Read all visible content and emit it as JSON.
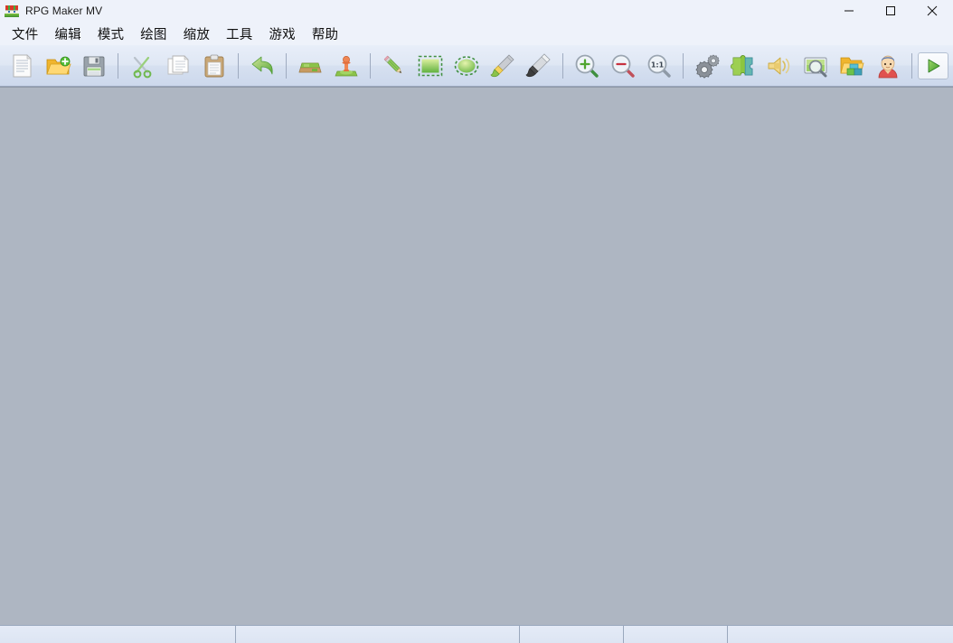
{
  "window": {
    "title": "RPG Maker MV",
    "app_icon": "rpgmaker-logo-icon",
    "controls": {
      "minimize": "–",
      "maximize": "□",
      "close": "✕"
    }
  },
  "menubar": {
    "items": [
      {
        "label": "文件",
        "name": "menu-file"
      },
      {
        "label": "编辑",
        "name": "menu-edit"
      },
      {
        "label": "模式",
        "name": "menu-mode"
      },
      {
        "label": "绘图",
        "name": "menu-draw"
      },
      {
        "label": "缩放",
        "name": "menu-zoom"
      },
      {
        "label": "工具",
        "name": "menu-tools"
      },
      {
        "label": "游戏",
        "name": "menu-game"
      },
      {
        "label": "帮助",
        "name": "menu-help"
      }
    ]
  },
  "toolbar": {
    "groups": [
      {
        "name": "file-group",
        "buttons": [
          {
            "name": "new-project-button",
            "icon": "new-document-icon"
          },
          {
            "name": "open-project-button",
            "icon": "open-folder-icon"
          },
          {
            "name": "save-project-button",
            "icon": "floppy-save-icon"
          }
        ]
      },
      {
        "name": "clipboard-group",
        "buttons": [
          {
            "name": "cut-button",
            "icon": "scissors-icon"
          },
          {
            "name": "copy-button",
            "icon": "copy-pages-icon"
          },
          {
            "name": "paste-button",
            "icon": "clipboard-icon"
          }
        ]
      },
      {
        "name": "history-group",
        "buttons": [
          {
            "name": "undo-button",
            "icon": "undo-arrow-icon"
          }
        ]
      },
      {
        "name": "mode-group",
        "buttons": [
          {
            "name": "map-mode-button",
            "icon": "map-layer-icon"
          },
          {
            "name": "event-mode-button",
            "icon": "event-pawn-icon"
          }
        ]
      },
      {
        "name": "draw-group",
        "buttons": [
          {
            "name": "pencil-tool-button",
            "icon": "pencil-icon"
          },
          {
            "name": "rectangle-tool-button",
            "icon": "rectangle-select-icon"
          },
          {
            "name": "ellipse-tool-button",
            "icon": "ellipse-select-icon"
          },
          {
            "name": "fill-tool-button",
            "icon": "paint-brush-fill-icon"
          },
          {
            "name": "shadow-pen-tool-button",
            "icon": "shadow-pen-icon"
          }
        ]
      },
      {
        "name": "zoom-group",
        "buttons": [
          {
            "name": "zoom-in-button",
            "icon": "magnifier-plus-icon"
          },
          {
            "name": "zoom-out-button",
            "icon": "magnifier-minus-icon"
          },
          {
            "name": "zoom-actual-button",
            "icon": "magnifier-1to1-icon",
            "label": "1:1"
          }
        ]
      },
      {
        "name": "resources-group",
        "buttons": [
          {
            "name": "database-button",
            "icon": "gears-icon"
          },
          {
            "name": "plugin-manager-button",
            "icon": "puzzle-piece-icon"
          },
          {
            "name": "sound-test-button",
            "icon": "speaker-icon"
          },
          {
            "name": "event-search-button",
            "icon": "screen-search-icon"
          },
          {
            "name": "resource-manager-button",
            "icon": "resource-folder-icon"
          },
          {
            "name": "character-generator-button",
            "icon": "character-head-icon"
          }
        ]
      },
      {
        "name": "run-group",
        "buttons": [
          {
            "name": "playtest-button",
            "icon": "play-triangle-icon"
          }
        ]
      }
    ]
  },
  "workspace": {
    "name": "map-editor-canvas",
    "background_color": "#aeb6c2",
    "content": ""
  },
  "statusbar": {
    "cells": [
      {
        "name": "status-cell-message",
        "text": ""
      },
      {
        "name": "status-cell-map-name",
        "text": ""
      },
      {
        "name": "status-cell-coords",
        "text": ""
      },
      {
        "name": "status-cell-scale",
        "text": ""
      },
      {
        "name": "status-cell-tile",
        "text": ""
      }
    ]
  },
  "colors": {
    "chrome": "#eef2fa",
    "toolbar_top": "#e8eef9",
    "toolbar_bottom": "#ccd8ec",
    "canvas": "#aeb6c2",
    "border": "#9aa8bd",
    "text": "#101010",
    "accent_green": "#7ec44a"
  }
}
